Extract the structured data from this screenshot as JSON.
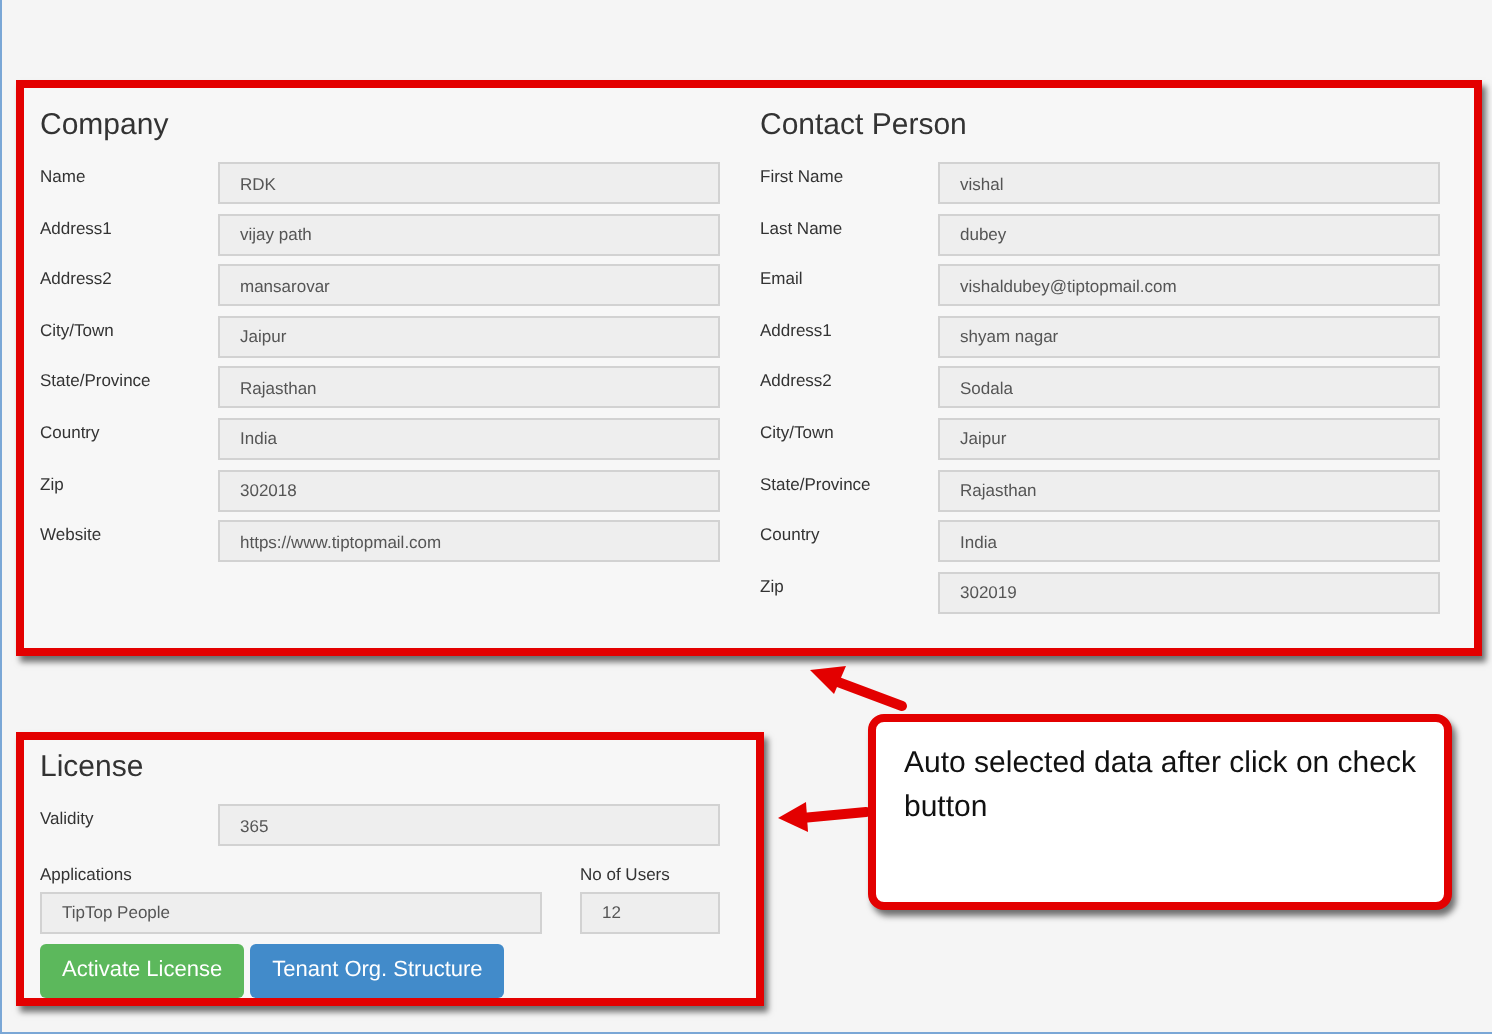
{
  "company": {
    "title": "Company",
    "fields": [
      {
        "label": "Name",
        "value": "RDK"
      },
      {
        "label": "Address1",
        "value": "vijay path"
      },
      {
        "label": "Address2",
        "value": "mansarovar"
      },
      {
        "label": "City/Town",
        "value": "Jaipur"
      },
      {
        "label": "State/Province",
        "value": "Rajasthan"
      },
      {
        "label": "Country",
        "value": "India"
      },
      {
        "label": "Zip",
        "value": "302018"
      },
      {
        "label": "Website",
        "value": "https://www.tiptopmail.com"
      }
    ]
  },
  "contact_person": {
    "title": "Contact Person",
    "fields": [
      {
        "label": "First Name",
        "value": "vishal"
      },
      {
        "label": "Last Name",
        "value": "dubey"
      },
      {
        "label": "Email",
        "value": "vishaldubey@tiptopmail.com"
      },
      {
        "label": "Address1",
        "value": "shyam nagar"
      },
      {
        "label": "Address2",
        "value": "Sodala"
      },
      {
        "label": "City/Town",
        "value": "Jaipur"
      },
      {
        "label": "State/Province",
        "value": "Rajasthan"
      },
      {
        "label": "Country",
        "value": "India"
      },
      {
        "label": "Zip",
        "value": "302019"
      }
    ]
  },
  "license": {
    "title": "License",
    "validity": {
      "label": "Validity",
      "value": "365"
    },
    "applications": {
      "label": "Applications",
      "value": "TipTop People"
    },
    "users": {
      "label": "No of Users",
      "value": "12"
    },
    "buttons": [
      {
        "label": "Activate License",
        "kind": "success"
      },
      {
        "label": "Tenant Org. Structure",
        "kind": "primary"
      }
    ]
  },
  "annotation": {
    "text": "Auto selected data after click on check button"
  }
}
